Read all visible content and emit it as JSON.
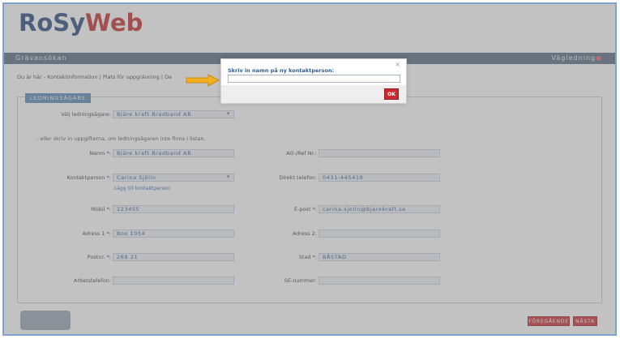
{
  "brand": {
    "part1": "RoSy",
    "part2": "Web"
  },
  "topbar": {
    "title": "Grävansökan",
    "help": "Vägledning"
  },
  "breadcrumb": "Du är här - Kontaktinformation | Plats för uppgrävning | De",
  "section": {
    "legend": "LEDNINGSÄGARE",
    "owner_label": "Välj ledningsägare:",
    "owner_value": "Bjäre kraft Bredband AB",
    "note": "- eller skriv in uppgifterna, om ledningsägaren inte finns i listan."
  },
  "form": {
    "name_label": "Namn *:",
    "name_value": "Bjäre kraft Bredband AB",
    "ao_label": "AO-/Ref Nr.:",
    "ao_value": "",
    "contact_label": "Kontaktperson *:",
    "contact_value": "Carina Sjölin",
    "add_contact_link": "Lägg till kontaktperson",
    "direct_phone_label": "Direkt telefon:",
    "direct_phone_value": "0431-445418",
    "mobile_label": "Mobil *:",
    "mobile_value": "123455",
    "email_label": "E-post *:",
    "email_value": "carina.sjolin@bjarekraft.se",
    "address1_label": "Adress 1 *:",
    "address1_value": "Box 1054",
    "address2_label": "Adress 2:",
    "address2_value": "",
    "postal_label": "Postnr. *:",
    "postal_value": "269 21",
    "city_label": "Stad *:",
    "city_value": "BÅSTAD",
    "workphone_label": "Arbetstelefon:",
    "workphone_value": "",
    "se_label": "SE-nummer:",
    "se_value": ""
  },
  "buttons": {
    "prev": "FÖREGÅENDE",
    "next": "NÄSTA"
  },
  "dialog": {
    "title": "Skriv in namn på ny kontaktperson:",
    "close": "×",
    "input_value": "",
    "ok": "OK"
  },
  "colors": {
    "accent": "#c9333a",
    "brand_blue": "#2b4c7c",
    "bar": "#5a6f84",
    "arrow": "#f0b020"
  }
}
